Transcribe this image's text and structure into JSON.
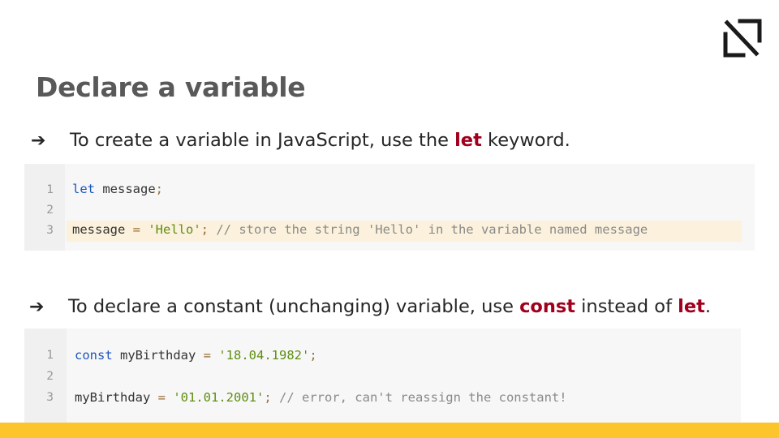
{
  "slide": {
    "title": "Declare a variable",
    "accent_color": "#fbc52b",
    "keyword_color": "#a0001c",
    "logo_icon": "corner-slash-logo-icon"
  },
  "bullets": [
    {
      "arrow": "➔",
      "before": "To create a variable in JavaScript, use the ",
      "keyword": "let",
      "after": " keyword."
    },
    {
      "arrow": "➔",
      "before": "To declare a constant (unchanging) variable, use ",
      "keyword1": "const",
      "middle": " instead of ",
      "keyword2": "let",
      "after": "."
    }
  ],
  "code_block_1": {
    "line_numbers": [
      "1",
      "2",
      "3"
    ],
    "line1": {
      "kw": "let",
      "rest": " message",
      "semi": ";"
    },
    "line3": {
      "id": "message",
      "op": " = ",
      "str": "'Hello'",
      "semi": ";",
      "comment": " // store the string 'Hello' in the variable named message"
    }
  },
  "code_block_2": {
    "line_numbers": [
      "1",
      "2",
      "3"
    ],
    "line1": {
      "kw": "const",
      "id": " myBirthday",
      "op": " = ",
      "str": "'18.04.1982'",
      "semi": ";"
    },
    "line3": {
      "id": "myBirthday",
      "op": " = ",
      "str": "'01.01.2001'",
      "semi": ";",
      "comment": " // error, can't reassign the constant!"
    }
  }
}
